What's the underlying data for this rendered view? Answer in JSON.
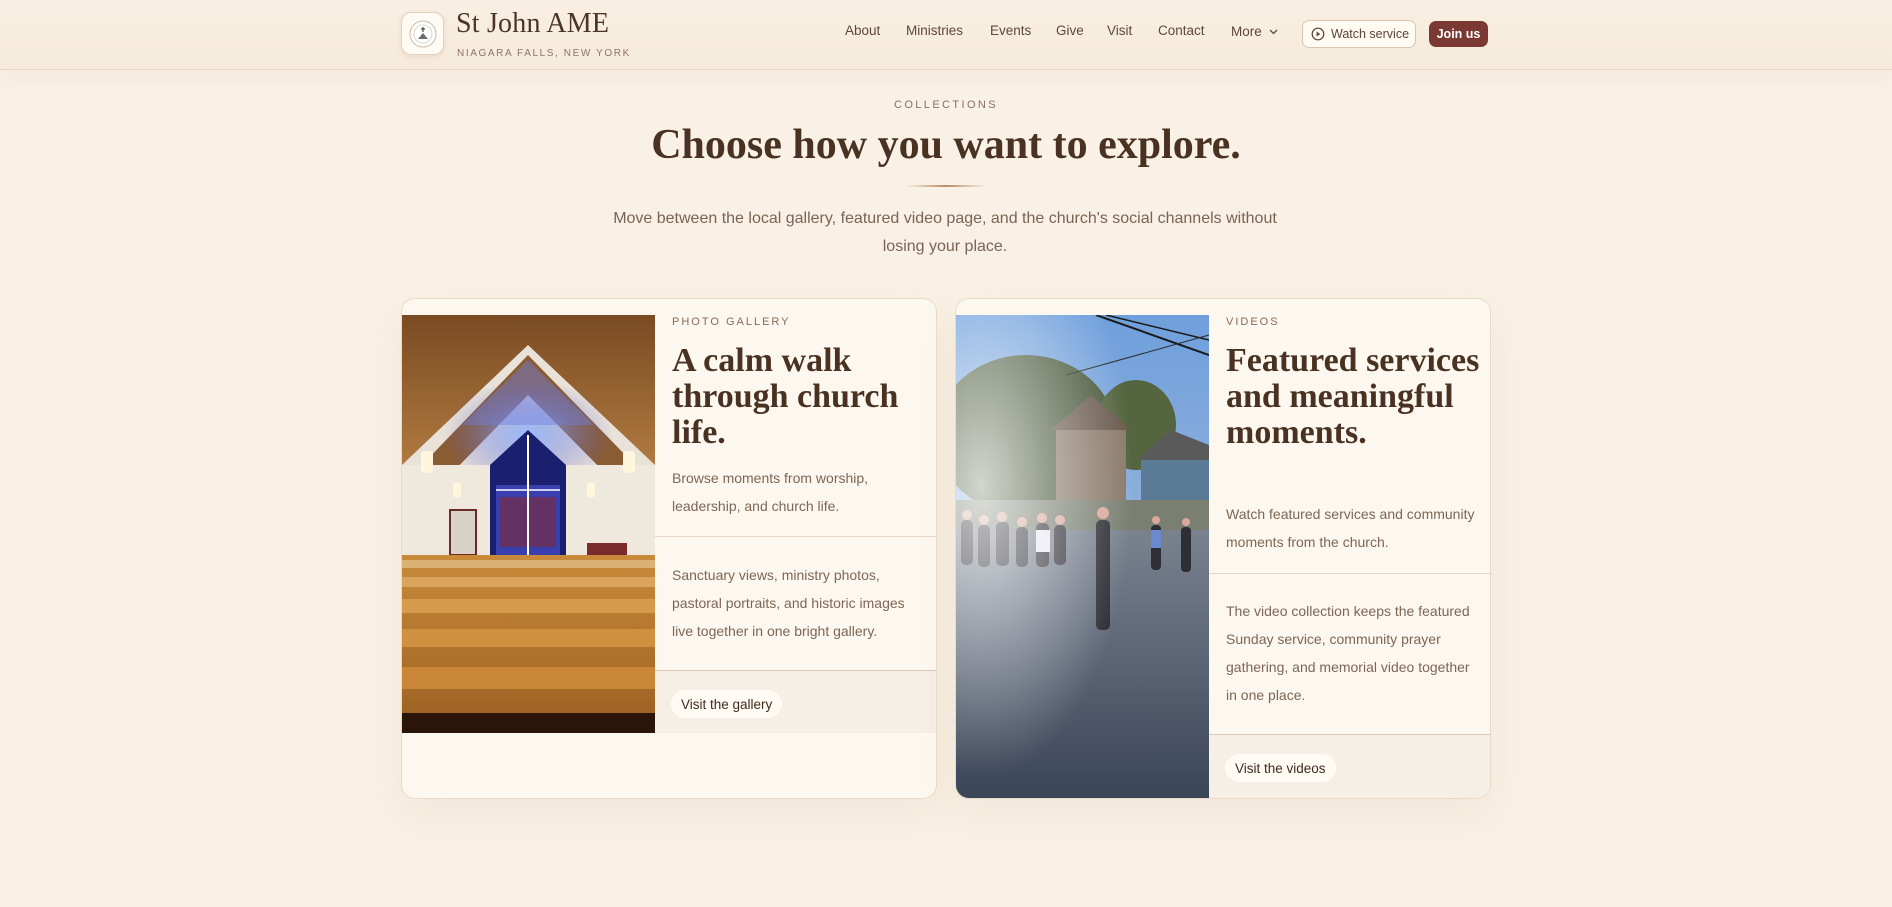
{
  "brand": {
    "name": "St John AME",
    "location": "NIAGARA FALLS, NEW YORK",
    "logo_icon": "church-seal-icon"
  },
  "nav": {
    "items": [
      "About",
      "Ministries",
      "Events",
      "Give",
      "Visit",
      "Contact"
    ],
    "more_label": "More",
    "watch_label": "Watch service",
    "join_label": "Join us"
  },
  "intro": {
    "eyebrow": "COLLECTIONS",
    "title": "Choose how you want to explore.",
    "text": "Move between the local gallery, featured video page, and the church's social channels without losing your place."
  },
  "cards": [
    {
      "eyebrow": "PHOTO GALLERY",
      "title": "A calm walk through church life.",
      "summary": "Browse moments from worship, leadership, and church life.",
      "detail": "Sanctuary views, ministry photos, pastoral portraits, and historic images live together in one bright gallery.",
      "link_label": "Visit the gallery",
      "image": "sanctuary-interior-photo"
    },
    {
      "eyebrow": "VIDEOS",
      "title": "Featured services and meaningful moments.",
      "summary": "Watch featured services and community moments from the church.",
      "detail": "The video collection keeps the featured Sunday service, community prayer gathering, and memorial video together in one place.",
      "link_label": "Visit the videos",
      "image": "outdoor-prayer-gathering-photo"
    }
  ],
  "colors": {
    "background": "#f9f1e5",
    "accent": "#7a3a33",
    "heading": "#4a3222",
    "body_text": "#7d6655"
  }
}
